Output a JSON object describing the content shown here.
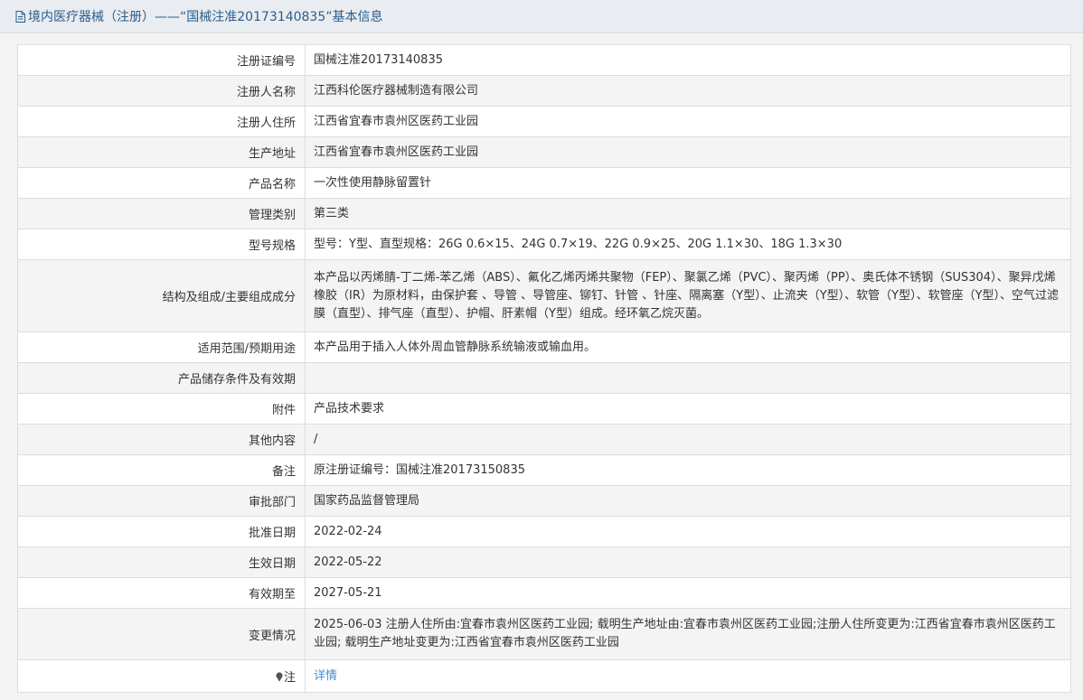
{
  "header": {
    "title": "境内医疗器械（注册）——“国械注准20173140835”基本信息"
  },
  "rows": [
    {
      "label": "注册证编号",
      "value": "国械注准20173140835"
    },
    {
      "label": "注册人名称",
      "value": "江西科伦医疗器械制造有限公司"
    },
    {
      "label": "注册人住所",
      "value": "江西省宜春市袁州区医药工业园"
    },
    {
      "label": "生产地址",
      "value": "江西省宜春市袁州区医药工业园"
    },
    {
      "label": "产品名称",
      "value": "一次性使用静脉留置针"
    },
    {
      "label": "管理类别",
      "value": "第三类"
    },
    {
      "label": "型号规格",
      "value": "型号：Y型、直型规格：26G 0.6×15、24G 0.7×19、22G 0.9×25、20G 1.1×30、18G 1.3×30"
    },
    {
      "label": "结构及组成/主要组成成分",
      "value": "本产品以丙烯腈-丁二烯-苯乙烯（ABS）、氟化乙烯丙烯共聚物（FEP）、聚氯乙烯（PVC）、聚丙烯（PP）、奥氏体不锈钢（SUS304）、聚异戊烯橡胶（IR）为原材料，由保护套 、导管 、导管座、铆钉、针管 、针座、隔离塞（Y型）、止流夹（Y型）、软管（Y型）、软管座（Y型）、空气过滤膜（直型）、排气座（直型）、护帽、肝素帽（Y型）组成。经环氧乙烷灭菌。"
    },
    {
      "label": "适用范围/预期用途",
      "value": "本产品用于插入人体外周血管静脉系统输液或输血用。"
    },
    {
      "label": "产品储存条件及有效期",
      "value": ""
    },
    {
      "label": "附件",
      "value": "产品技术要求"
    },
    {
      "label": "其他内容",
      "value": "/"
    },
    {
      "label": "备注",
      "value": "原注册证编号：国械注准20173150835"
    },
    {
      "label": "审批部门",
      "value": "国家药品监督管理局"
    },
    {
      "label": "批准日期",
      "value": "2022-02-24"
    },
    {
      "label": "生效日期",
      "value": "2022-05-22"
    },
    {
      "label": "有效期至",
      "value": "2027-05-21"
    },
    {
      "label": "变更情况",
      "value": "2025-06-03 注册人住所由:宜春市袁州区医药工业园; 载明生产地址由:宜春市袁州区医药工业园;注册人住所变更为:江西省宜春市袁州区医药工业园; 载明生产地址变更为:江西省宜春市袁州区医药工业园"
    },
    {
      "label": "注",
      "value": "详情"
    }
  ],
  "icons": {
    "header": "document-icon",
    "note": "pin-icon"
  },
  "colors": {
    "header_text": "#2b5d8c",
    "link": "#3f8fd2"
  }
}
